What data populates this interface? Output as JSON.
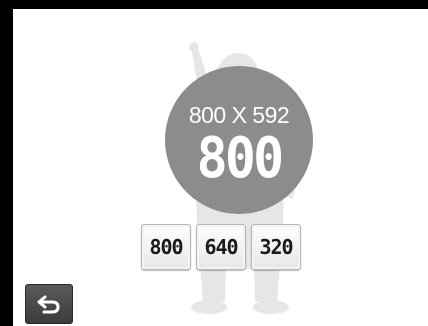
{
  "resolution": {
    "dimensions": "800 X 592",
    "current": "800"
  },
  "options": [
    {
      "label": "800"
    },
    {
      "label": "640"
    },
    {
      "label": "320"
    }
  ],
  "colors": {
    "circle": "#8c8c8c",
    "silhouette": "#e6e6e6",
    "back_button": "#4a4a4a"
  },
  "icons": {
    "back": "return-arrow-icon",
    "background": "child-silhouette-icon"
  }
}
